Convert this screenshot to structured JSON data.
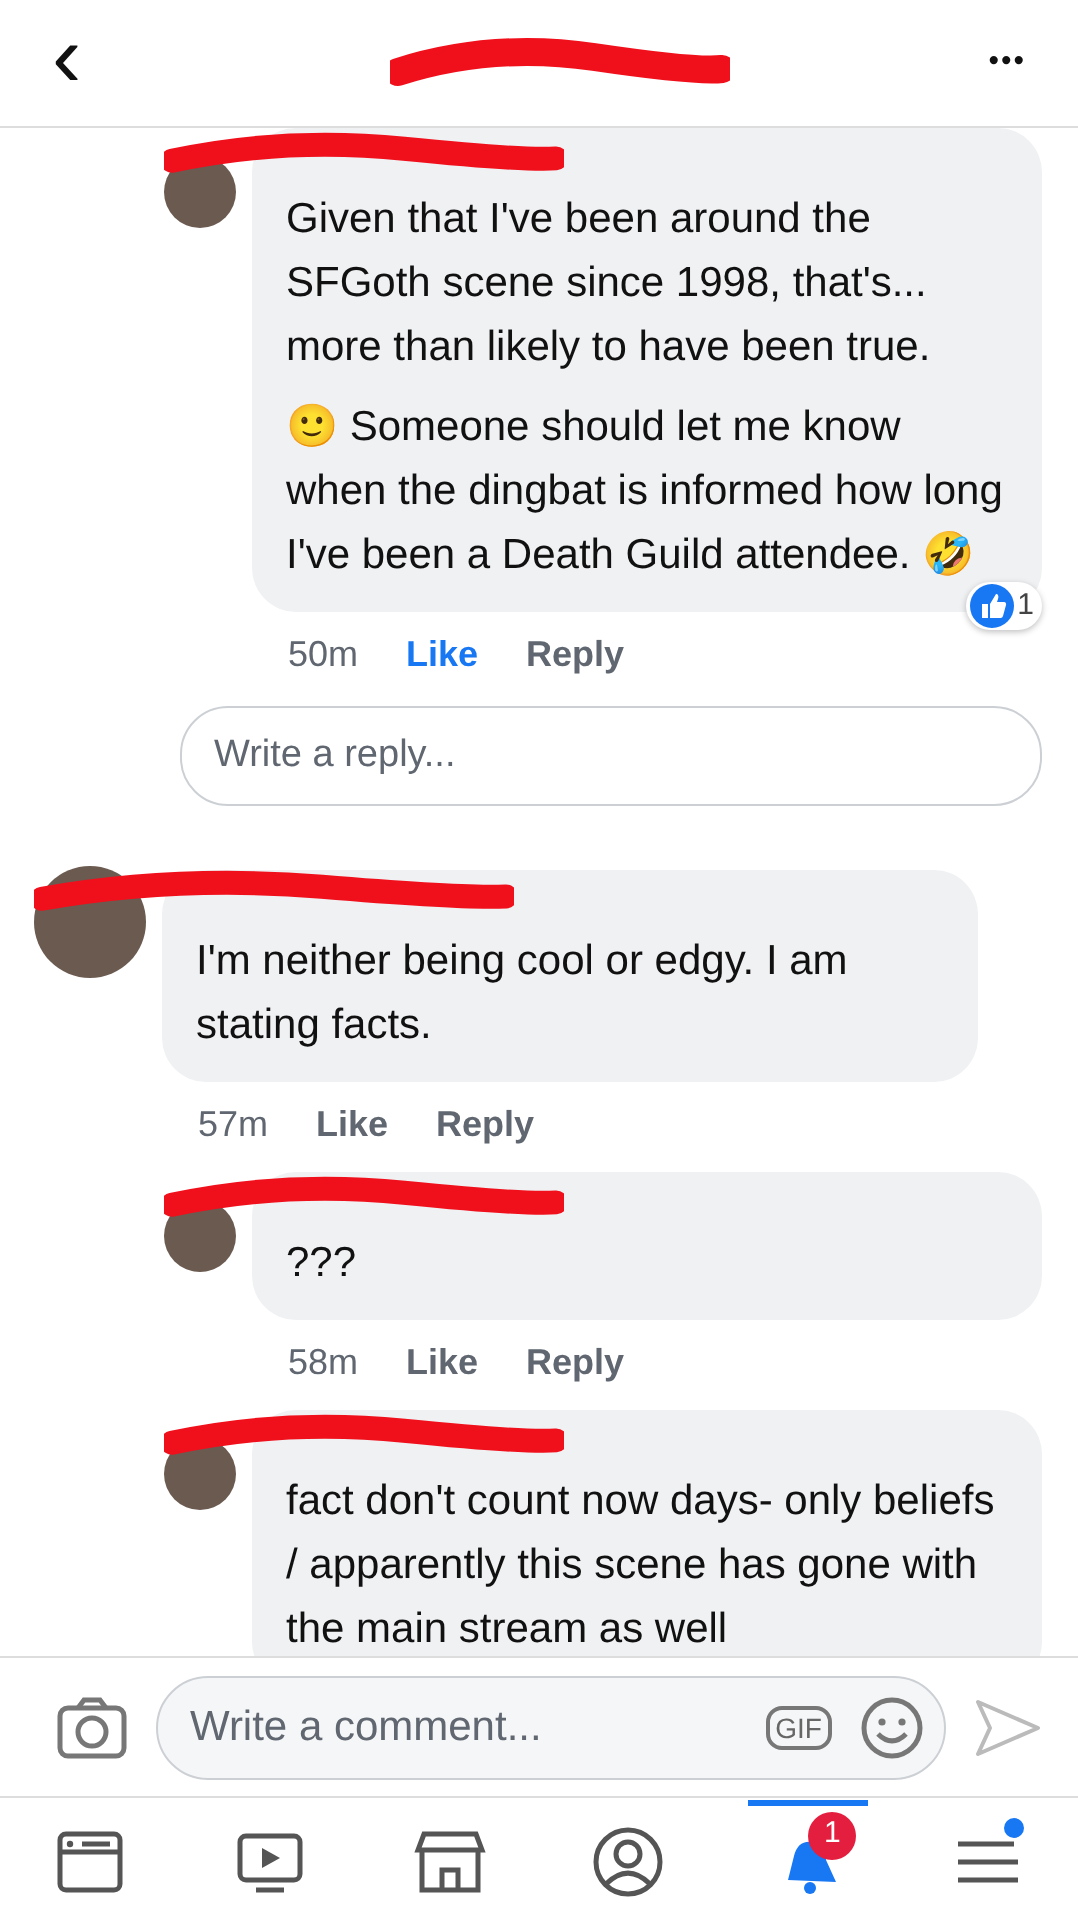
{
  "header": {
    "back": "‹",
    "more": "•••"
  },
  "comments": [
    {
      "kind": "reply",
      "paragraphs": [
        "Given that I've been around the SFGoth scene since 1998, that's... more than likely to have been true.",
        "🙂 Someone should let me know when the dingbat is informed how long I've been a Death Guild attendee. 🤣"
      ],
      "time": "50m",
      "like": "Like",
      "liked": true,
      "reply": "Reply",
      "reactions": "1"
    },
    {
      "kind": "reply-box",
      "placeholder": "Write a reply..."
    },
    {
      "kind": "comment",
      "paragraphs": [
        "I'm neither being cool or edgy.  I am stating facts."
      ],
      "time": "57m",
      "like": "Like",
      "liked": false,
      "reply": "Reply"
    },
    {
      "kind": "reply",
      "paragraphs": [
        "???"
      ],
      "time": "58m",
      "like": "Like",
      "liked": false,
      "reply": "Reply"
    },
    {
      "kind": "reply",
      "paragraphs": [
        "fact don't count now days- only beliefs / apparently this scene has gone with the main stream as well"
      ]
    }
  ],
  "composer": {
    "placeholder": "Write a comment...",
    "gif": "GIF"
  },
  "tabs": [
    {
      "kind": "news",
      "selected": false
    },
    {
      "kind": "video",
      "selected": false
    },
    {
      "kind": "market",
      "selected": false
    },
    {
      "kind": "profile",
      "selected": false
    },
    {
      "kind": "bell",
      "selected": true,
      "badge": "1"
    },
    {
      "kind": "menu",
      "selected": false,
      "dot": true
    }
  ]
}
